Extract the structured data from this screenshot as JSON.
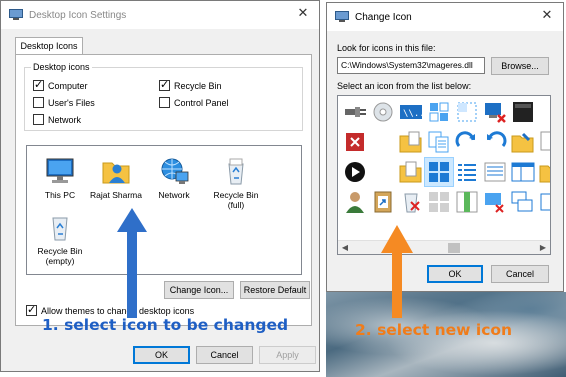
{
  "left_window": {
    "title": "Desktop Icon Settings",
    "tab_label": "Desktop Icons",
    "group_title": "Desktop icons",
    "checkboxes": [
      {
        "label": "Computer",
        "checked": true
      },
      {
        "label": "Recycle Bin",
        "checked": true
      },
      {
        "label": "User's Files",
        "checked": false
      },
      {
        "label": "Control Panel",
        "checked": false
      },
      {
        "label": "Network",
        "checked": false
      }
    ],
    "desktop_items": [
      {
        "label": "This PC",
        "icon": "this-pc-icon"
      },
      {
        "label": "Rajat Sharma",
        "icon": "user-folder-icon"
      },
      {
        "label": "Network",
        "icon": "network-icon"
      },
      {
        "label": "Recycle Bin (full)",
        "icon": "recycle-bin-full-icon"
      },
      {
        "label": "Recycle Bin (empty)",
        "icon": "recycle-bin-empty-icon"
      }
    ],
    "change_icon_button": "Change Icon...",
    "restore_default_button": "Restore Default",
    "allow_themes_label": "Allow themes to change desktop icons",
    "allow_themes_checked": true,
    "ok_button": "OK",
    "cancel_button": "Cancel",
    "apply_button": "Apply"
  },
  "right_window": {
    "title": "Change Icon",
    "look_for_label": "Look for icons in this file:",
    "file_path": "C:\\Windows\\System32\\mageres.dll",
    "browse_button": "Browse...",
    "select_label": "Select an icon from the list below:",
    "ok_button": "OK",
    "cancel_button": "Cancel"
  },
  "annotations": {
    "left": "1. select icon to be changed",
    "right": "2. select new icon",
    "left_color": "#1f5fc4",
    "right_color": "#f07c1a"
  }
}
